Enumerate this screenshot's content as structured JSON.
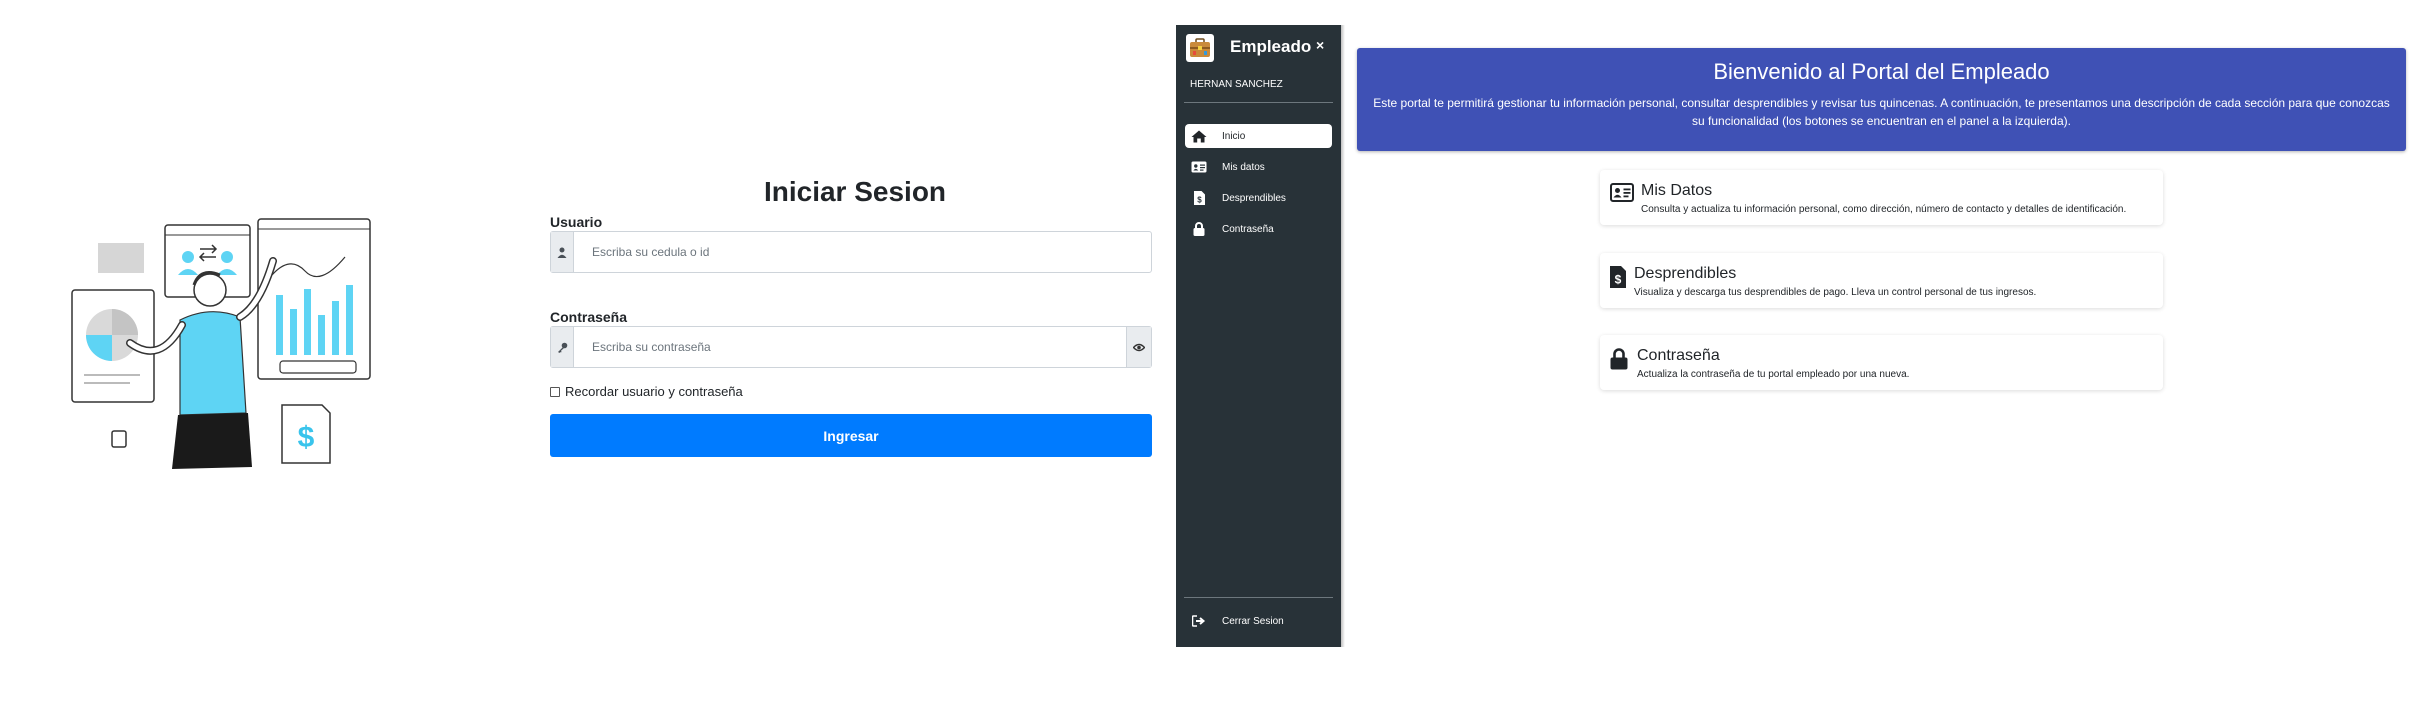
{
  "login": {
    "title": "Iniciar Sesion",
    "username_label": "Usuario",
    "username_placeholder": "Escriba su cedula o id",
    "password_label": "Contraseña",
    "password_placeholder": "Escriba su contraseña",
    "remember_label": "Recordar usuario y contraseña",
    "submit_label": "Ingresar",
    "accent_color": "#007bff"
  },
  "sidebar": {
    "title": "Empleado",
    "close_symbol": "×",
    "user_name": "HERNAN SANCHEZ",
    "items": [
      {
        "label": "Inicio",
        "icon": "home-icon",
        "active": true
      },
      {
        "label": "Mis datos",
        "icon": "id-card-icon",
        "active": false
      },
      {
        "label": "Desprendibles",
        "icon": "file-invoice-dollar-icon",
        "active": false
      },
      {
        "label": "Contraseña",
        "icon": "lock-icon",
        "active": false
      }
    ],
    "logout_label": "Cerrar Sesion",
    "background_color": "#283238"
  },
  "main": {
    "banner": {
      "title": "Bienvenido al Portal del Empleado",
      "description": "Este portal te permitirá gestionar tu información personal, consultar desprendibles y revisar tus quincenas. A continuación, te presentamos una descripción de cada sección para que conozcas su funcionalidad (los botones se encuentran en el panel a la izquierda).",
      "color": "#3f51b5"
    },
    "cards": [
      {
        "title": "Mis Datos",
        "description": "Consulta y actualiza tu información personal, como dirección, número de contacto y detalles de identificación.",
        "icon": "id-card-icon"
      },
      {
        "title": "Desprendibles",
        "description": "Visualiza y descarga tus desprendibles de pago. Lleva un control personal de tus ingresos.",
        "icon": "file-invoice-dollar-icon"
      },
      {
        "title": "Contraseña",
        "description": "Actualiza la contraseña de tu portal empleado por una nueva.",
        "icon": "lock-icon"
      }
    ]
  }
}
